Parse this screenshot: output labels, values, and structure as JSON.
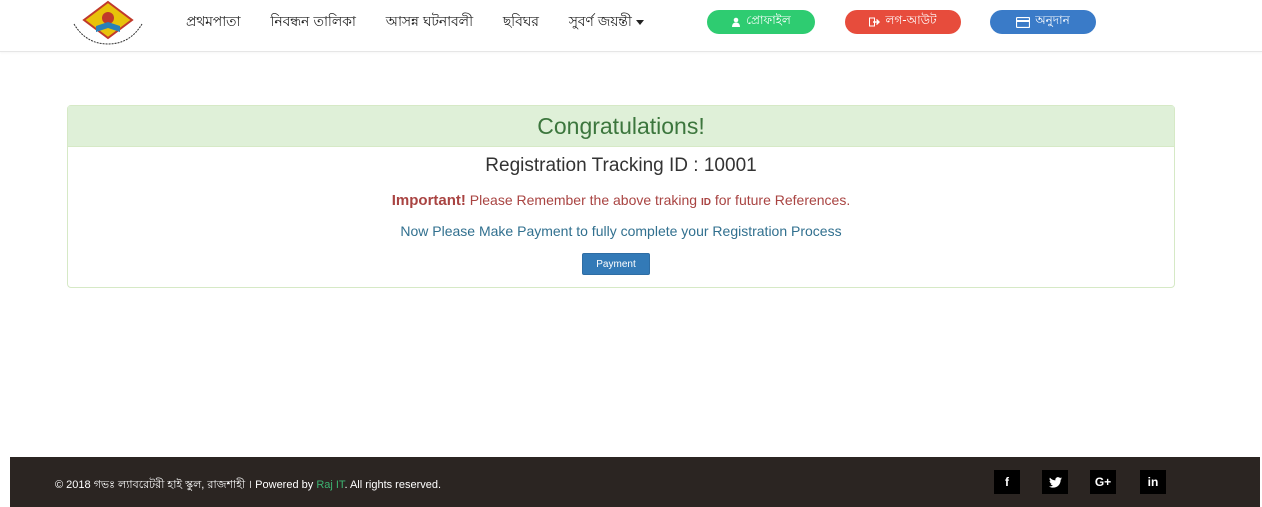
{
  "nav": {
    "links": [
      "প্রথমপাতা",
      "নিবন্ধন তালিকা",
      "আসন্ন ঘটনাবলী",
      "ছবিঘর",
      "সুবর্ণ জয়ন্তী"
    ],
    "profile_label": "প্রোফাইল",
    "logout_label": "লগ-আউট",
    "donate_label": "অনুদান"
  },
  "panel": {
    "title": "Congratulations!",
    "tracking_label": "Registration Tracking ID : 10001",
    "important_strong": "Important!",
    "important_text_1": " Please Remember the above traking ",
    "important_id": "ID",
    "important_text_2": " for future References.",
    "payment_text": "Now Please Make Payment to fully complete your Registration Process",
    "payment_button": "Payment"
  },
  "footer": {
    "copyright_prefix": "© 2018 গভঃ ল্যাবরেটরী হাই স্কুল, রাজশাহী । Powered by ",
    "brand": "Raj IT",
    "copyright_suffix": ". All rights reserved.",
    "social": [
      "f",
      "",
      "G+",
      "in"
    ]
  },
  "colors": {
    "profile": "#2ecc71",
    "logout": "#e74c3c",
    "donate": "#3a7bc8",
    "panel_header": "#dff0d8",
    "footer_bg": "#2b2522"
  }
}
